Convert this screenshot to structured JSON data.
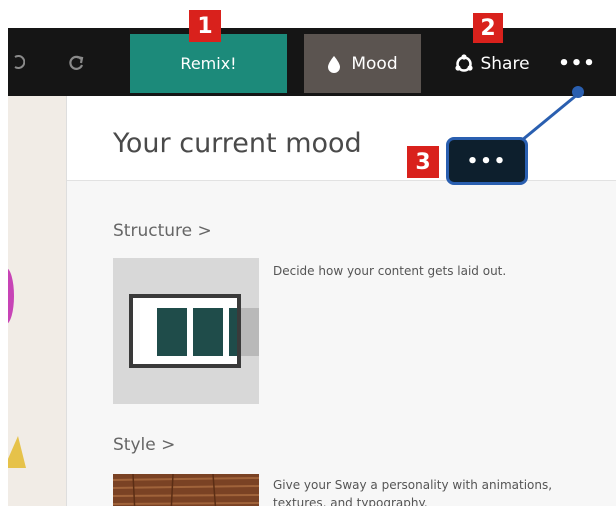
{
  "toolbar": {
    "undo_icon": "undo-icon",
    "redo_icon": "redo-icon",
    "remix_label": "Remix!",
    "mood_label": "Mood",
    "mood_icon": "droplet-icon",
    "share_label": "Share",
    "share_icon": "share-icon",
    "more_label": "•••"
  },
  "callouts": {
    "one": "1",
    "two": "2",
    "three": "3",
    "three_pill": "•••"
  },
  "panel": {
    "title": "Your current mood",
    "structure": {
      "title": "Structure >",
      "description": "Decide how your content gets laid out."
    },
    "style": {
      "title": "Style >",
      "description": "Give your Sway a personality with animations, textures, and typography."
    }
  },
  "colors": {
    "toolbar_bg": "#151515",
    "remix_bg": "#1c8a7a",
    "mood_bg": "#5b5450",
    "badge_red": "#d9211c",
    "callout_blue": "#2a5fb0",
    "thumb_teal": "#1f4c4a"
  }
}
